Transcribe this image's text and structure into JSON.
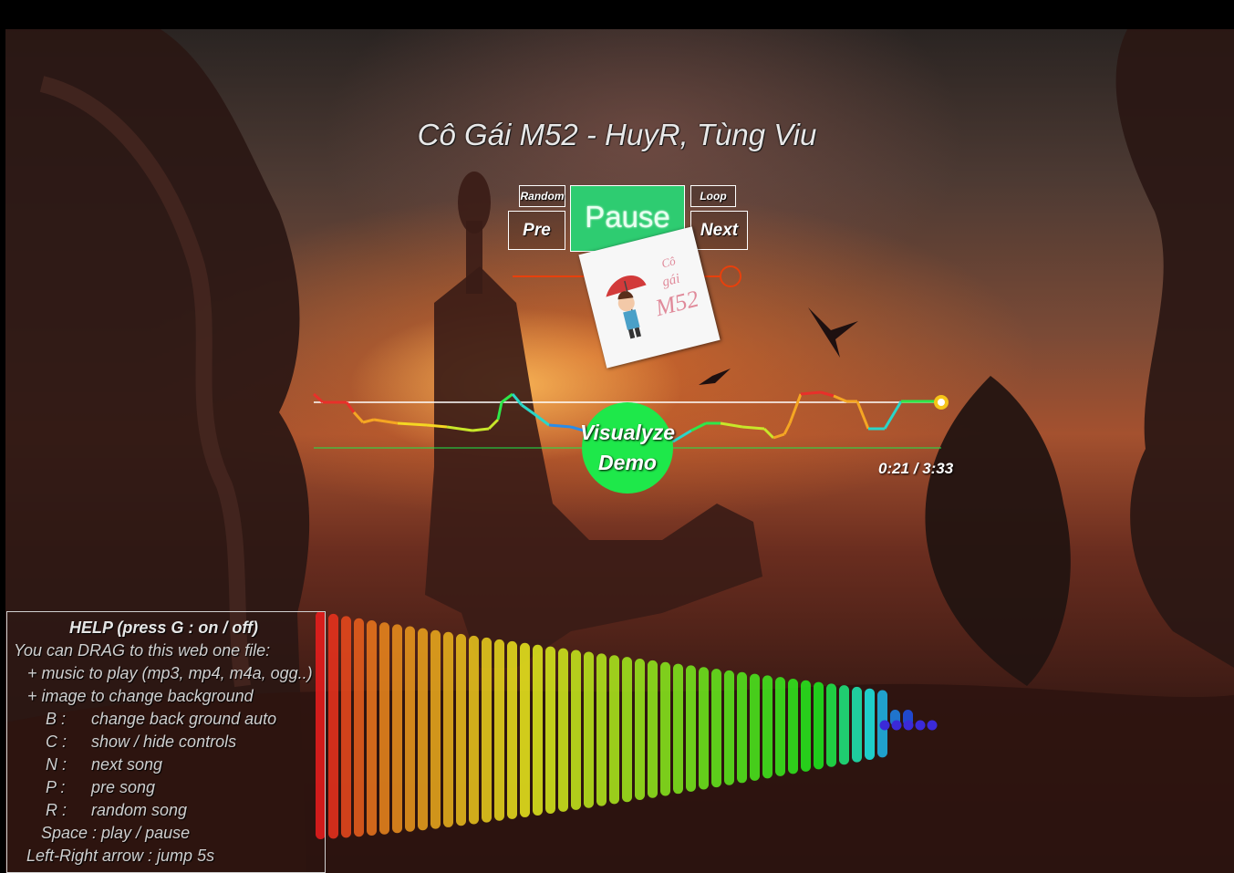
{
  "player": {
    "title": "Cô Gái M52 - HuyR, Tùng Viu",
    "random_label": "Random",
    "loop_label": "Loop",
    "pre_label": "Pre",
    "next_label": "Next",
    "pause_label": "Pause",
    "time": "0:21 / 3:33",
    "progress_fraction": 0.1,
    "volume_fraction": 0.95
  },
  "cover": {
    "line1": "Cô",
    "line2": "gái",
    "line3": "M52"
  },
  "visualizer": {
    "label_line1": "Visualyze",
    "label_line2": "Demo"
  },
  "help": {
    "title": "HELP (press G : on / off)",
    "drag_intro": "You can DRAG to this web one file:",
    "drag_music": "+ music to play (mp3, mp4, m4a, ogg..)",
    "drag_image": "+ image to change background",
    "keys": [
      {
        "key": "B :",
        "desc": "change back ground auto"
      },
      {
        "key": "C :",
        "desc": "show / hide controls"
      },
      {
        "key": "N :",
        "desc": "next song"
      },
      {
        "key": "P :",
        "desc": "pre song"
      },
      {
        "key": "R :",
        "desc": "random song"
      }
    ],
    "space": "Space :  play / pause",
    "arrows": "Left-Right arrow : jump 5s"
  },
  "colors": {
    "pause_bg": "#2ecc71",
    "viz_circle": "#1ee84a",
    "progress": "#e8400c"
  }
}
